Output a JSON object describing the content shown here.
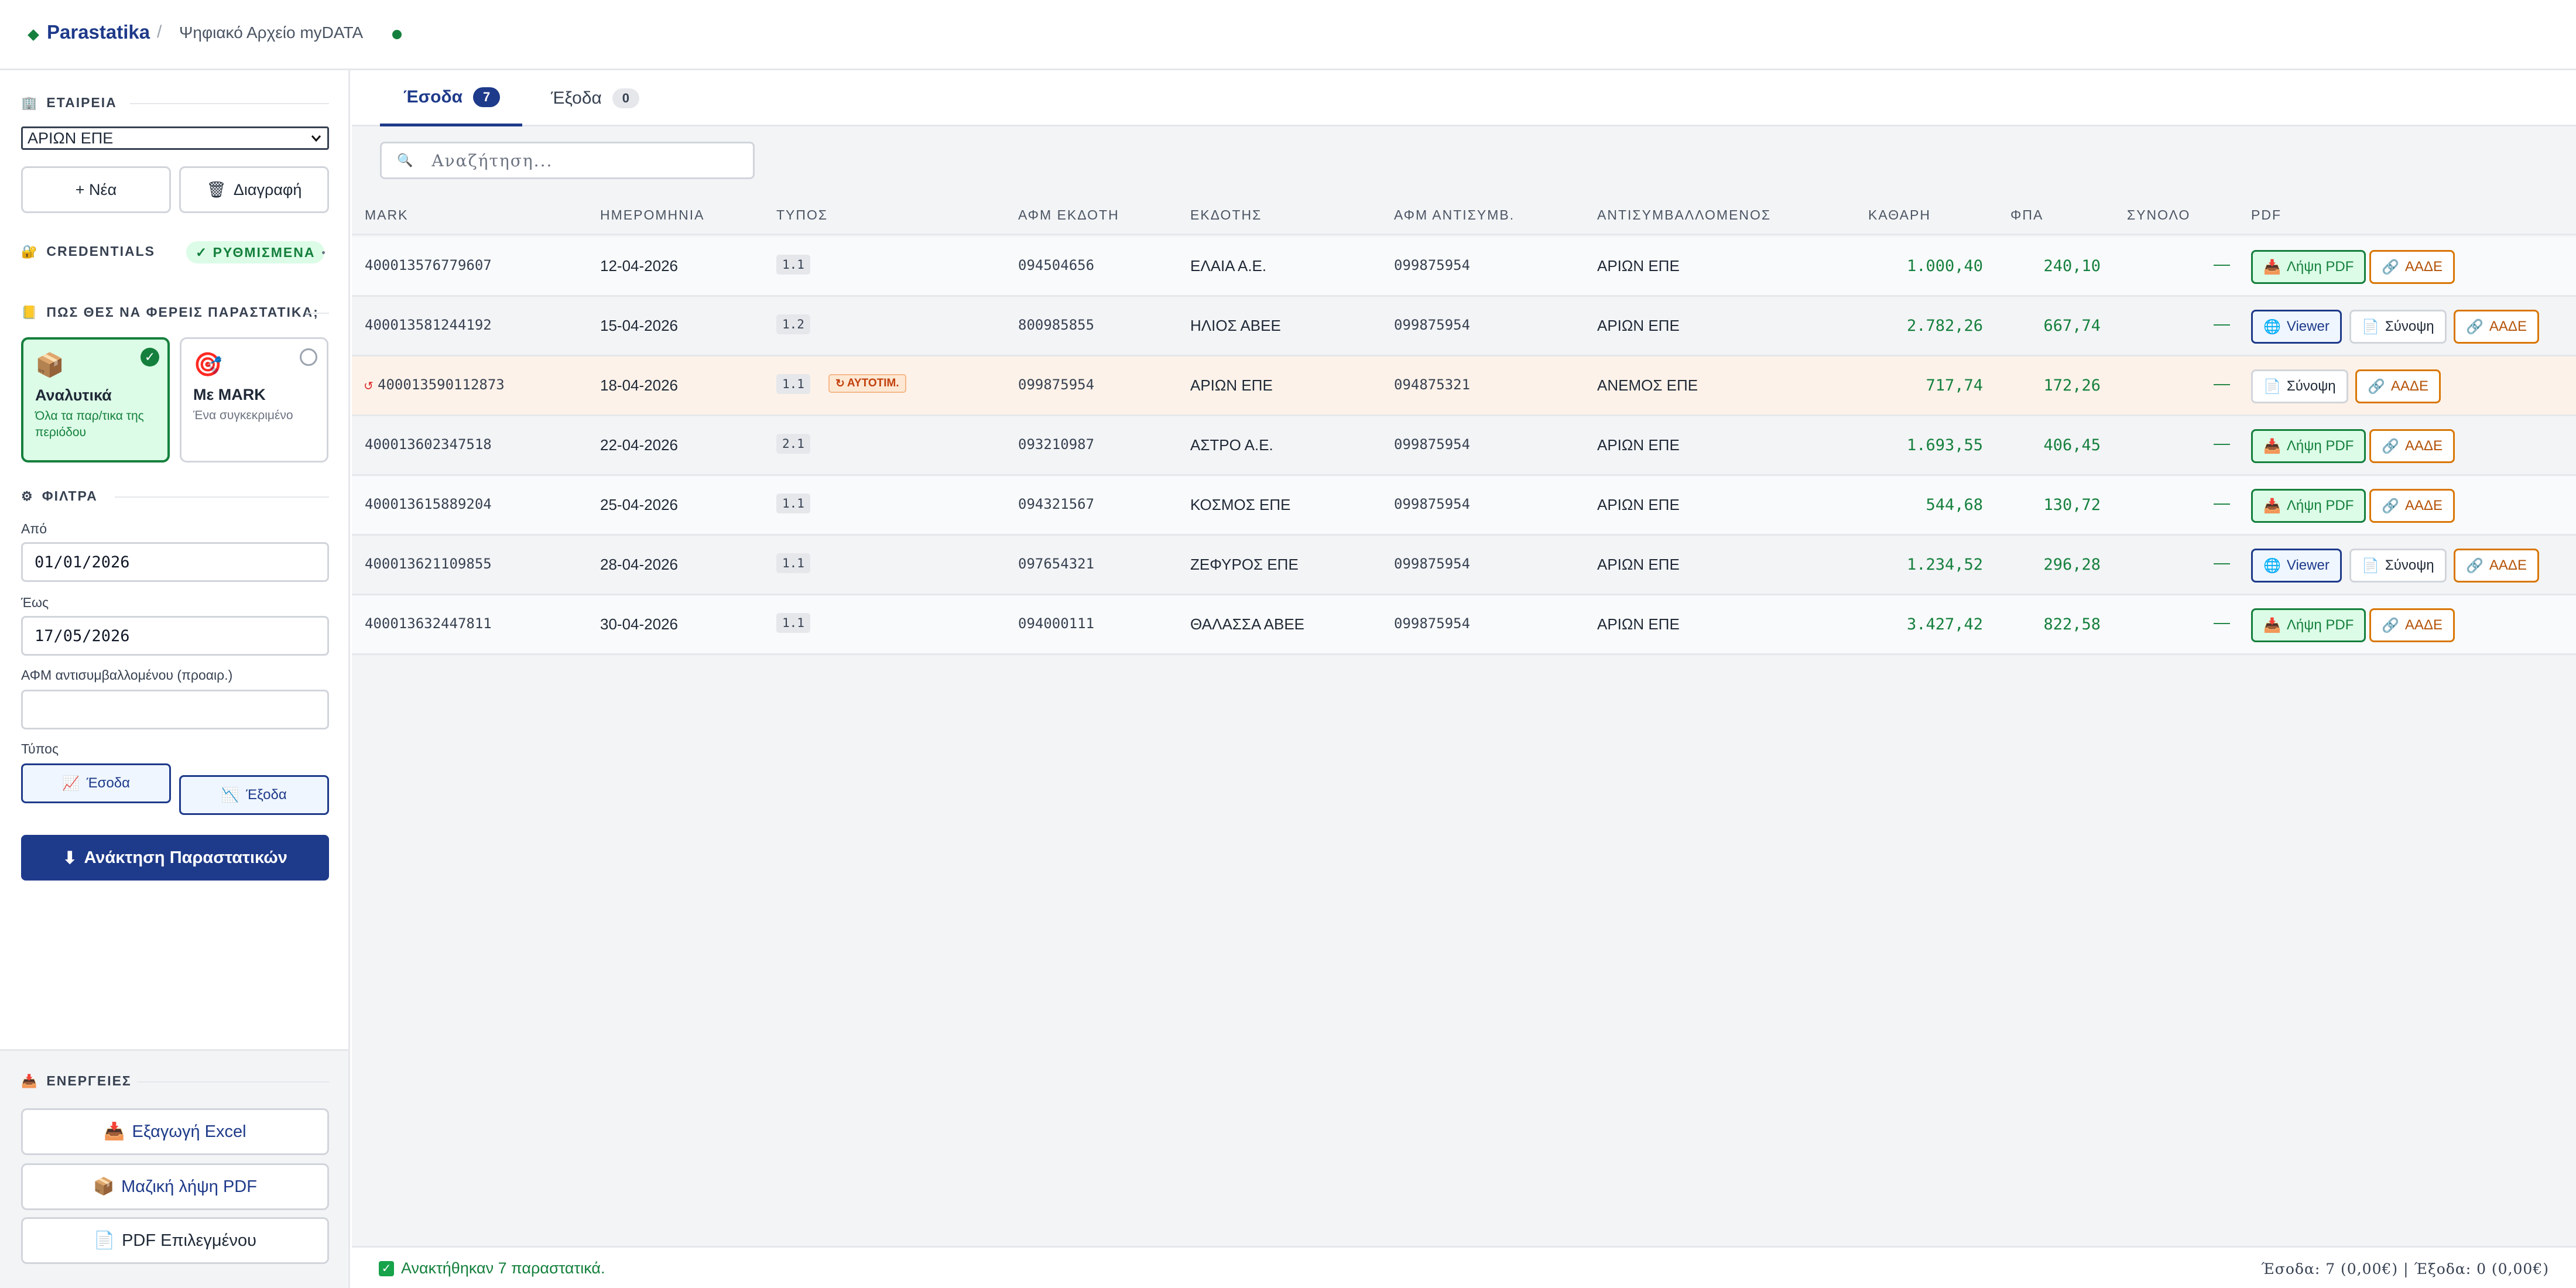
{
  "header": {
    "brand": "Parastatika",
    "separator": "/",
    "crumb": "Ψηφιακό Αρχείο myDATA"
  },
  "sidebar": {
    "company": {
      "title": "ΕΤΑΙΡΕΙΑ",
      "selected": "ΑΡΙΩΝ ΕΠΕ",
      "new_label": "+ Νέα",
      "delete_label": "Διαγραφή"
    },
    "credentials": {
      "title": "CREDENTIALS",
      "status": "✓ ΡΥΘΜΙΣΜΕΝΑ"
    },
    "fetch": {
      "title": "ΠΩΣ ΘΕΣ ΝΑ ΦΕΡΕΙΣ ΠΑΡΑΣΤΑΤΙΚΑ;",
      "options": [
        {
          "title": "Αναλυτικά",
          "subtitle": "Όλα τα παρ/τικα της περιόδου",
          "selected": true
        },
        {
          "title": "Με MARK",
          "subtitle": "Ένα συγκεκριμένο",
          "selected": false
        }
      ]
    },
    "filters": {
      "title": "ΦΙΛΤΡΑ",
      "from_label": "Από",
      "from_value": "01/01/2026",
      "to_label": "Έως",
      "to_value": "17/05/2026",
      "afm_label": "ΑΦΜ αντισυμβαλλομένου (προαιρ.)",
      "afm_value": "",
      "type_label": "Τύπος",
      "type_income": "Έσοδα",
      "type_expense": "Έξοδα"
    },
    "submit_label": "Ανάκτηση Παραστατικών",
    "actions": {
      "title": "ΕΝΕΡΓΕΙΕΣ",
      "excel": "Εξαγωγή Excel",
      "bulk_pdf": "Μαζική λήψη PDF",
      "selected_pdf": "PDF Επιλεγμένου"
    }
  },
  "tabs": [
    {
      "label": "Έσοδα",
      "count": "7"
    },
    {
      "label": "Έξοδα",
      "count": "0"
    }
  ],
  "search": {
    "placeholder": "Αναζήτηση..."
  },
  "table": {
    "headers": [
      "MARK",
      "ΗΜΕΡΟΜΗΝΙΑ",
      "ΤΥΠΟΣ",
      "ΑΦΜ ΕΚΔΟΤΗ",
      "ΕΚΔΟΤΗΣ",
      "ΑΦΜ ΑΝΤΙΣΥΜΒ.",
      "ΑΝΤΙΣΥΜΒΑΛΛΟΜΕΝΟΣ",
      "ΚΑΘΑΡΗ",
      "ΦΠΑ",
      "ΣΥΝΟΛΟ",
      "PDF"
    ],
    "rows": [
      {
        "mark": "400013576779607",
        "date": "12-04-2026",
        "type": "1.1",
        "issuer_afm": "094504656",
        "issuer": "ΕΛΑΙΑ Α.Ε.",
        "counter_afm": "099875954",
        "counterparty": "ΑΡΙΩΝ ΕΠΕ",
        "net": "1.000,40",
        "vat": "240,10",
        "total": "—",
        "buttons": [
          "Λήψη PDF",
          "ΑΑΔΕ"
        ]
      },
      {
        "mark": "400013581244192",
        "date": "15-04-2026",
        "type": "1.2",
        "issuer_afm": "800985855",
        "issuer": "ΗΛΙΟΣ ΑΒΕΕ",
        "counter_afm": "099875954",
        "counterparty": "ΑΡΙΩΝ ΕΠΕ",
        "net": "2.782,26",
        "vat": "667,74",
        "total": "—",
        "buttons": [
          "Viewer",
          "Σύνοψη",
          "ΑΑΔΕ"
        ]
      },
      {
        "mark": "400013590112873",
        "date": "18-04-2026",
        "type": "1.1",
        "auto_tag": "ΑΥΤΟΤΙΜ.",
        "issuer_afm": "099875954",
        "issuer": "ΑΡΙΩΝ ΕΠΕ",
        "counter_afm": "094875321",
        "counterparty": "ΑΝΕΜΟΣ ΕΠΕ",
        "net": "717,74",
        "vat": "172,26",
        "total": "—",
        "buttons": [
          "Σύνοψη",
          "ΑΑΔΕ"
        ]
      },
      {
        "mark": "400013602347518",
        "date": "22-04-2026",
        "type": "2.1",
        "issuer_afm": "093210987",
        "issuer": "ΑΣΤΡΟ Α.Ε.",
        "counter_afm": "099875954",
        "counterparty": "ΑΡΙΩΝ ΕΠΕ",
        "net": "1.693,55",
        "vat": "406,45",
        "total": "—",
        "buttons": [
          "Λήψη PDF",
          "ΑΑΔΕ"
        ]
      },
      {
        "mark": "400013615889204",
        "date": "25-04-2026",
        "type": "1.1",
        "issuer_afm": "094321567",
        "issuer": "ΚΟΣΜΟΣ ΕΠΕ",
        "counter_afm": "099875954",
        "counterparty": "ΑΡΙΩΝ ΕΠΕ",
        "net": "544,68",
        "vat": "130,72",
        "total": "—",
        "buttons": [
          "Λήψη PDF",
          "ΑΑΔΕ"
        ]
      },
      {
        "mark": "400013621109855",
        "date": "28-04-2026",
        "type": "1.1",
        "issuer_afm": "097654321",
        "issuer": "ΖΕΦΥΡΟΣ ΕΠΕ",
        "counter_afm": "099875954",
        "counterparty": "ΑΡΙΩΝ ΕΠΕ",
        "net": "1.234,52",
        "vat": "296,28",
        "total": "—",
        "buttons": [
          "Viewer",
          "Σύνοψη",
          "ΑΑΔΕ"
        ]
      },
      {
        "mark": "400013632447811",
        "date": "30-04-2026",
        "type": "1.1",
        "issuer_afm": "094000111",
        "issuer": "ΘΑΛΑΣΣΑ ΑΒΕΕ",
        "counter_afm": "099875954",
        "counterparty": "ΑΡΙΩΝ ΕΠΕ",
        "net": "3.427,42",
        "vat": "822,58",
        "total": "—",
        "buttons": [
          "Λήψη PDF",
          "ΑΑΔΕ"
        ]
      }
    ]
  },
  "footer": {
    "message": "Ανακτήθηκαν 7 παραστατικά.",
    "summary": "Έσοδα: 7 (0,00€) | Έξοδα: 0 (0,00€)"
  },
  "colors": {
    "primary": "#1e3a8a",
    "success": "#15803d",
    "warning": "#b45309",
    "highlight_row": "#fdf2e9"
  }
}
